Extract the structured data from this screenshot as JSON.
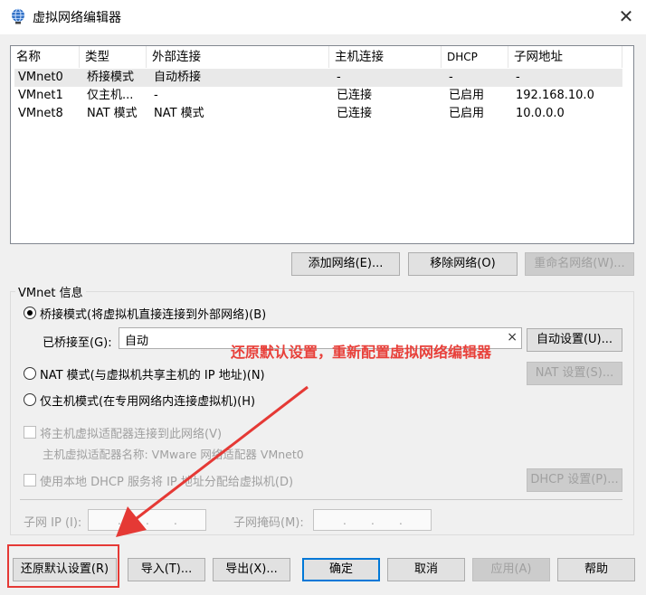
{
  "window": {
    "title": "虚拟网络编辑器",
    "close_glyph": "✕"
  },
  "table": {
    "columns": [
      "名称",
      "类型",
      "外部连接",
      "主机连接",
      "DHCP",
      "子网地址"
    ],
    "rows": [
      [
        "VMnet0",
        "桥接模式",
        "自动桥接",
        "-",
        "-",
        "-"
      ],
      [
        "VMnet1",
        "仅主机...",
        "-",
        "已连接",
        "已启用",
        "192.168.10.0"
      ],
      [
        "VMnet8",
        "NAT 模式",
        "NAT 模式",
        "已连接",
        "已启用",
        "10.0.0.0"
      ]
    ]
  },
  "list_buttons": {
    "add": "添加网络(E)...",
    "remove": "移除网络(O)",
    "rename": "重命名网络(W)..."
  },
  "vmnet_info": {
    "group_title": "VMnet 信息",
    "bridged_label": "桥接模式(将虚拟机直接连接到外部网络)(B)",
    "bridged_to_label": "已桥接至(G):",
    "bridged_to_value": "自动",
    "clear_glyph": "×",
    "auto_settings": "自动设置(U)...",
    "nat_label": "NAT 模式(与虚拟机共享主机的 IP 地址)(N)",
    "nat_settings": "NAT 设置(S)...",
    "hostonly_label": "仅主机模式(在专用网络内连接虚拟机)(H)",
    "connect_adapter_label": "将主机虚拟适配器连接到此网络(V)",
    "adapter_name_label": "主机虚拟适配器名称: VMware 网络适配器 VMnet0",
    "dhcp_label": "使用本地 DHCP 服务将 IP 地址分配给虚拟机(D)",
    "dhcp_settings": "DHCP 设置(P)...",
    "subnet_ip_label": "子网 IP (I):",
    "subnet_mask_label": "子网掩码(M):",
    "ip_dot": "."
  },
  "footer": {
    "restore": "还原默认设置(R)",
    "import": "导入(T)...",
    "export": "导出(X)...",
    "ok": "确定",
    "cancel": "取消",
    "apply": "应用(A)",
    "help": "帮助"
  },
  "annotation": {
    "text": "还原默认设置，重新配置虚拟网络编辑器",
    "color": "#e8403a"
  },
  "state": {
    "selected_row": "VMnet0",
    "mode": "bridged",
    "connect_adapter_checked": false,
    "dhcp_checked": false
  },
  "colors": {
    "accent": "#0078d7",
    "annotation": "#e53935"
  }
}
